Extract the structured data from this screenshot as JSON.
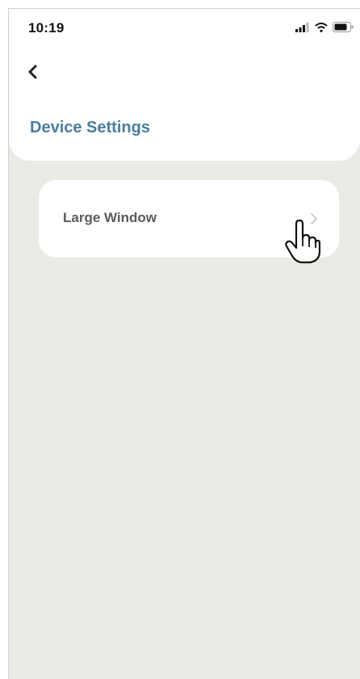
{
  "status_bar": {
    "time": "10:19",
    "icons": [
      "signal-icon",
      "wifi-icon",
      "battery-icon"
    ]
  },
  "nav": {
    "back_icon": "chevron-left-icon"
  },
  "header": {
    "title": "Device Settings"
  },
  "settings_list": {
    "items": [
      {
        "label": "Large Window",
        "icon": "chevron-right-icon"
      }
    ]
  },
  "colors": {
    "title": "#4a7d9c",
    "background": "#ebebe6",
    "card": "#ffffff",
    "item_text": "#5a5a5a"
  },
  "cursor": {
    "icon": "hand-pointer-icon"
  }
}
